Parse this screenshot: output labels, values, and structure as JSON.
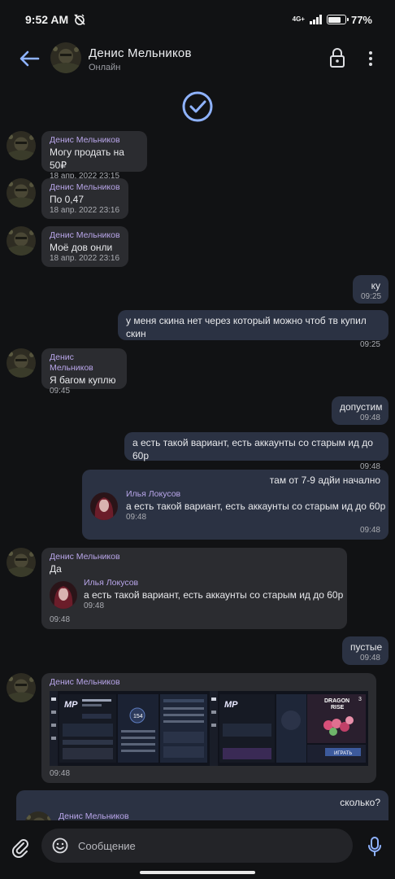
{
  "status_bar": {
    "time": "9:52 AM",
    "network": "4G+",
    "battery": "77%",
    "battery_level": 0.77
  },
  "header": {
    "contact_name": "Денис Мельников",
    "contact_status": "Онлайн"
  },
  "messages": [
    {
      "dir": "in",
      "sender": "Денис Мельников",
      "text": "Могу продать на 50₽",
      "time": "18 апр. 2022 23:15"
    },
    {
      "dir": "in",
      "sender": "Денис Мельников",
      "text": "По 0,47",
      "time": "18 апр. 2022 23:16"
    },
    {
      "dir": "in",
      "sender": "Денис Мельников",
      "text": "Моё дов онли",
      "time": "18 апр. 2022 23:16"
    },
    {
      "dir": "out",
      "text": "ку",
      "time": "09:25"
    },
    {
      "dir": "out",
      "text": "у меня скина нет через который можно чтоб тв купил скин",
      "time": "09:25"
    },
    {
      "dir": "in",
      "sender": "Денис Мельников",
      "text": "Я багом куплю",
      "time": "09:45"
    },
    {
      "dir": "out",
      "text": "допустим",
      "time": "09:48"
    },
    {
      "dir": "out",
      "text": "а есть такой вариант, есть аккаунты со старым ид до 60р",
      "time": "09:48"
    },
    {
      "dir": "out",
      "text": "там от 7-9 адйи начално",
      "time": "09:48",
      "forward": {
        "sender": "Илья Локусов",
        "text": "а есть такой вариант, есть аккаунты со старым ид до 60р",
        "time": "09:48"
      }
    },
    {
      "dir": "in",
      "sender": "Денис Мельников",
      "text": "Да",
      "time": "09:48",
      "forward": {
        "sender": "Илья Локусов",
        "text": "а есть такой вариант, есть аккаунты со старым ид до 60р",
        "time": "09:48"
      }
    },
    {
      "dir": "out",
      "text": "пустые",
      "time": "09:48"
    },
    {
      "dir": "in",
      "sender": "Денис Мельников",
      "time": "09:48",
      "images": {
        "badge_level": "154",
        "banner_title_1": "DRAGON",
        "banner_title_2": "RISE",
        "buy_label": "ИГРАТЬ",
        "count": "3"
      }
    },
    {
      "dir": "out",
      "text": "сколько?",
      "sender": "Денис Мельников"
    }
  ],
  "composer": {
    "placeholder": "Сообщение"
  },
  "colors": {
    "background": "#111214",
    "incoming_bubble": "#2b2c30",
    "outgoing_bubble": "#2b3243",
    "sender_name": "#b9a6ea",
    "accent": "#8fb3ff"
  }
}
